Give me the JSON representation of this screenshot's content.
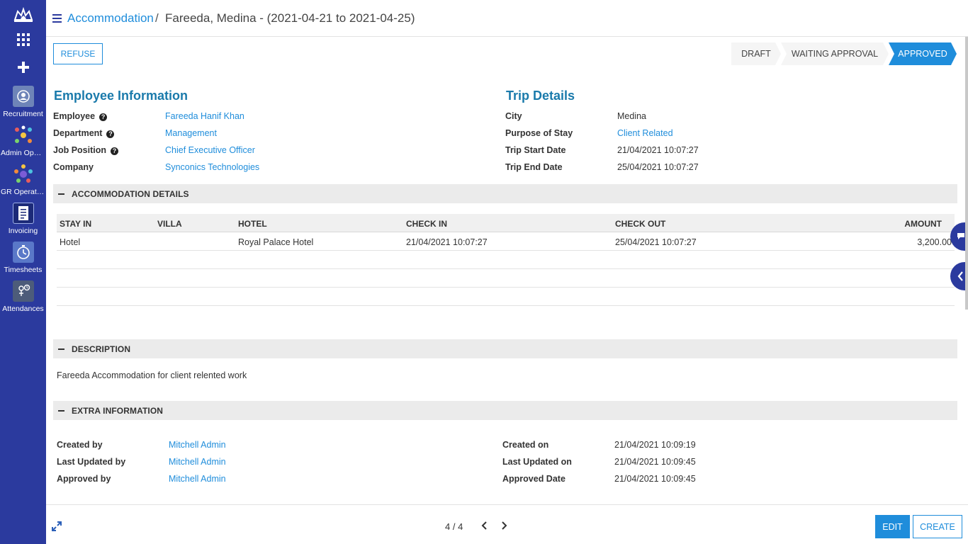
{
  "sidebar": {
    "apps": [
      {
        "label": "Recruitment",
        "icon": "recruitment-icon"
      },
      {
        "label": "Admin Oper...",
        "icon": "admin-operations-icon"
      },
      {
        "label": "GR Operatio...",
        "icon": "gr-operations-icon"
      },
      {
        "label": "Invoicing",
        "icon": "invoicing-icon"
      },
      {
        "label": "Timesheets",
        "icon": "timesheets-icon"
      },
      {
        "label": "Attendances",
        "icon": "attendances-icon"
      }
    ]
  },
  "header": {
    "breadcrumb_link": "Accommodation",
    "breadcrumb_sep": "/",
    "breadcrumb_current": "Fareeda, Medina - (2021-04-21 to 2021-04-25)"
  },
  "actions": {
    "refuse_label": "REFUSE"
  },
  "status_bar": {
    "steps": [
      "DRAFT",
      "WAITING APPROVAL",
      "APPROVED"
    ],
    "active": "APPROVED"
  },
  "employee": {
    "title": "Employee Information",
    "fields": [
      {
        "label": "Employee",
        "value": "Fareeda Hanif Khan"
      },
      {
        "label": "Department",
        "value": "Management"
      },
      {
        "label": "Job Position",
        "value": "Chief Executive Officer"
      },
      {
        "label": "Company",
        "value": "Synconics Technologies"
      }
    ]
  },
  "trip": {
    "title": "Trip Details",
    "fields": [
      {
        "label": "City",
        "value": "Medina"
      },
      {
        "label": "Purpose of Stay",
        "value": "Client Related"
      },
      {
        "label": "Trip Start Date",
        "value": "21/04/2021 10:07:27"
      },
      {
        "label": "Trip End Date",
        "value": "25/04/2021 10:07:27"
      }
    ]
  },
  "accommodation": {
    "section_title": "ACCOMMODATION DETAILS",
    "columns": [
      "STAY IN",
      "VILLA",
      "HOTEL",
      "CHECK IN",
      "CHECK OUT",
      "AMOUNT"
    ],
    "rows": [
      [
        "Hotel",
        "",
        "Royal Palace Hotel",
        "21/04/2021 10:07:27",
        "25/04/2021 10:07:27",
        "3,200.00"
      ]
    ]
  },
  "description": {
    "section_title": "DESCRIPTION",
    "text": "Fareeda Accommodation for client relented work"
  },
  "extra": {
    "section_title": "EXTRA INFORMATION",
    "left": [
      {
        "label": "Created by",
        "value": "Mitchell Admin"
      },
      {
        "label": "Last Updated by",
        "value": "Mitchell Admin"
      },
      {
        "label": "Approved by",
        "value": "Mitchell Admin"
      }
    ],
    "right": [
      {
        "label": "Created on",
        "value": "21/04/2021 10:09:19"
      },
      {
        "label": "Last Updated on",
        "value": "21/04/2021 10:09:45"
      },
      {
        "label": "Approved Date",
        "value": "21/04/2021 10:09:45"
      }
    ]
  },
  "footer": {
    "pager": "4 / 4",
    "edit_label": "EDIT",
    "create_label": "CREATE"
  },
  "colors": {
    "sidebar": "#2b3a9e",
    "accent": "#1f8ddb",
    "section_title": "#1a7aab"
  }
}
